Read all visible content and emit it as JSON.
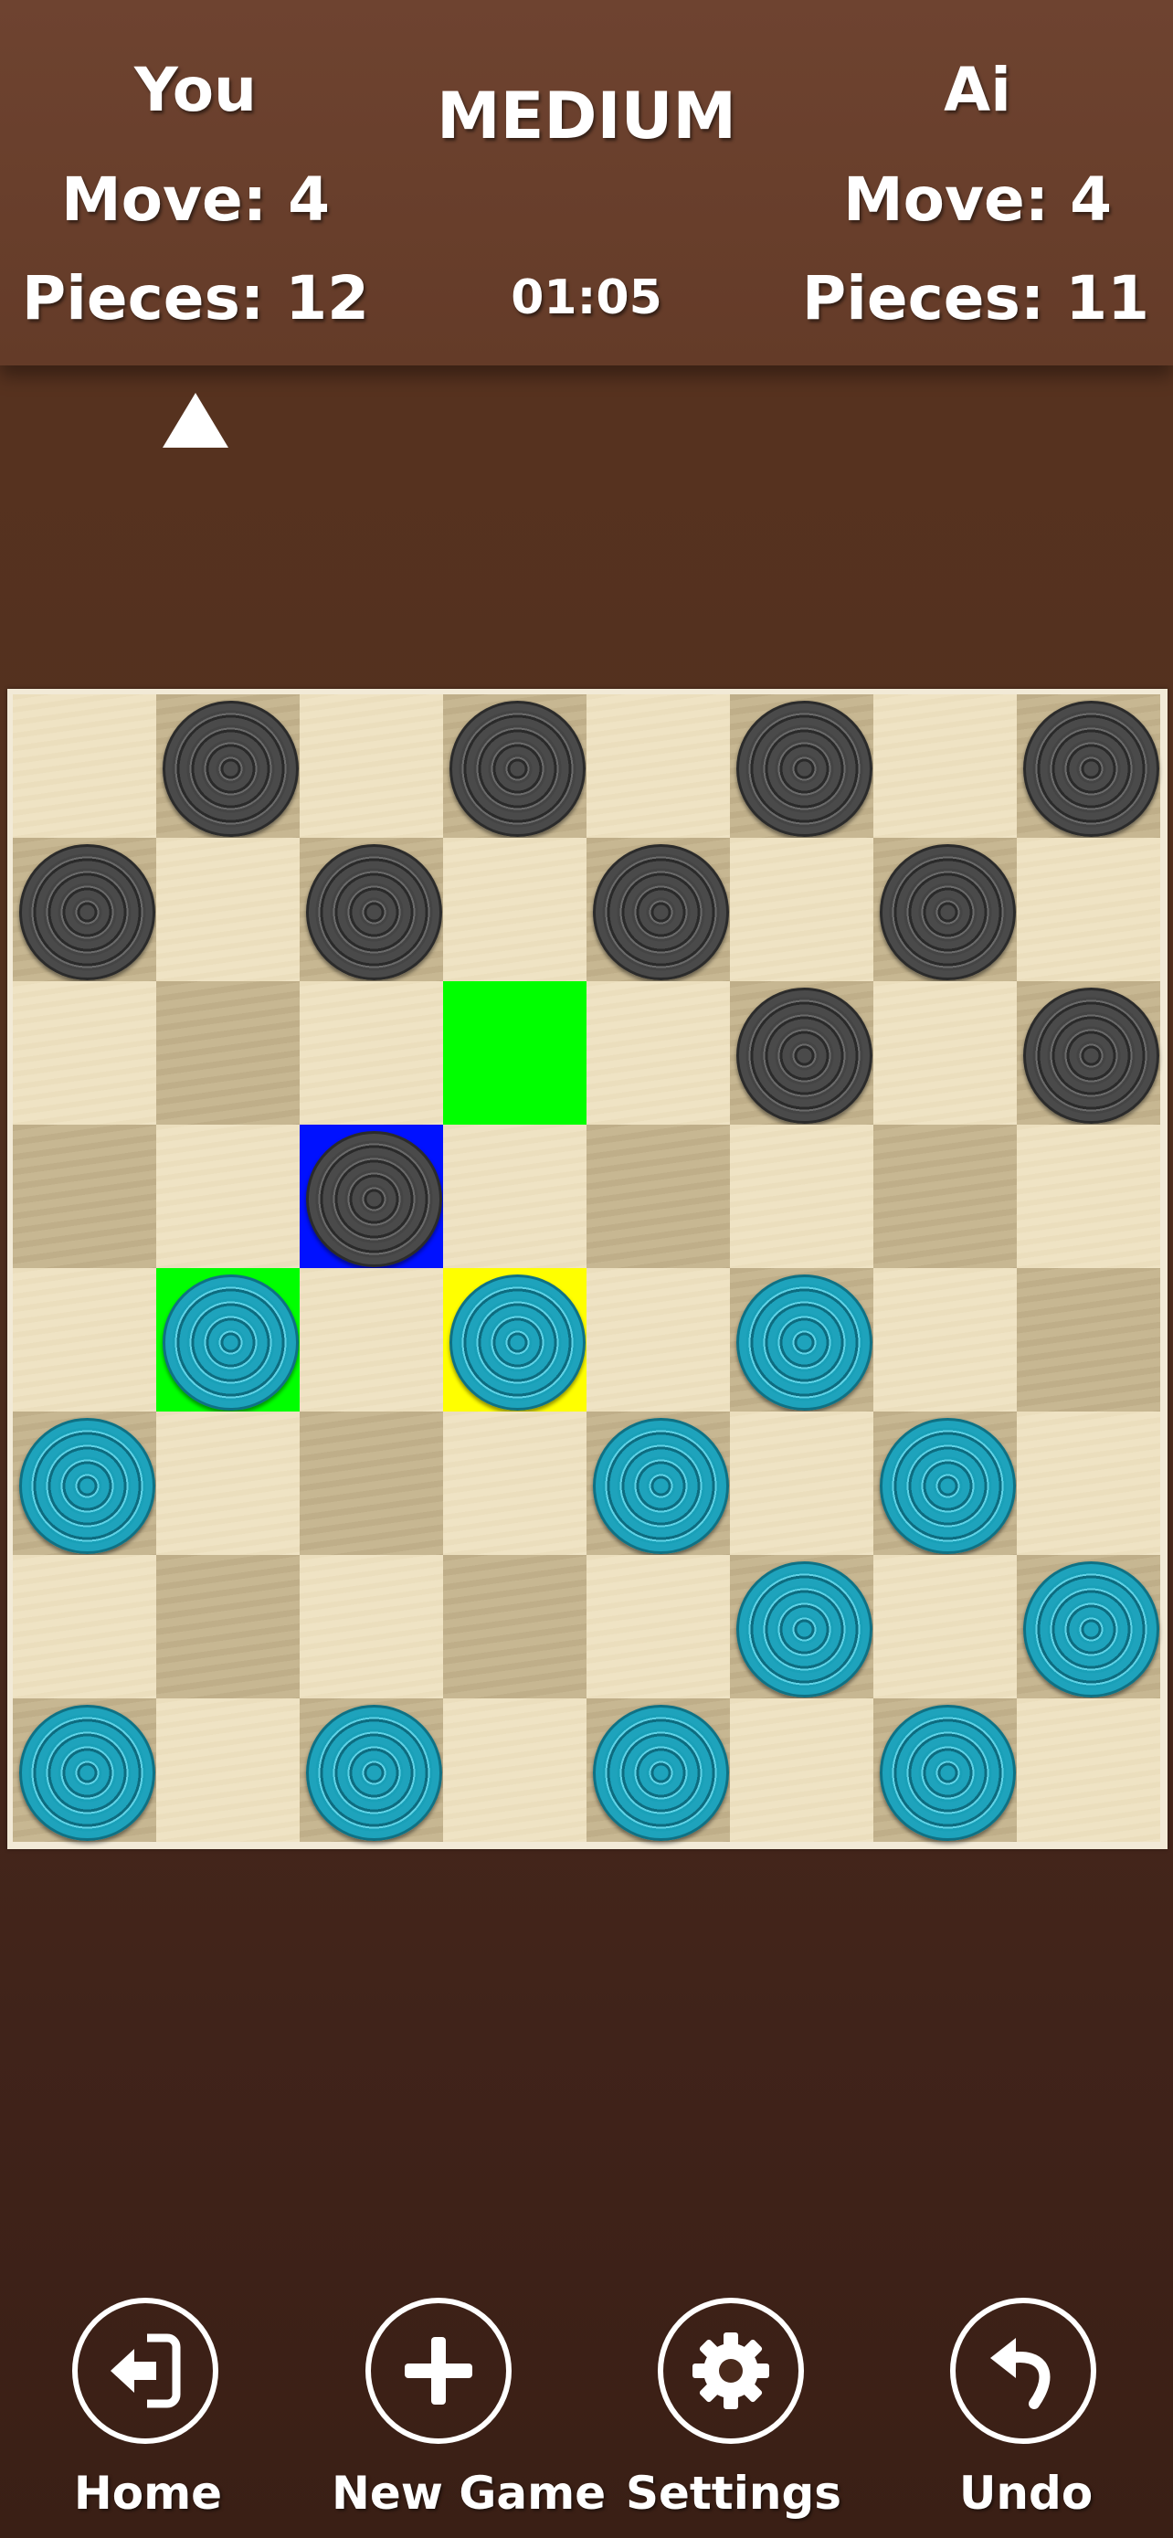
{
  "header": {
    "player": {
      "name": "You",
      "move": "Move: 4",
      "pieces": "Pieces: 12"
    },
    "difficulty": "MEDIUM",
    "timer": "01:05",
    "ai": {
      "name": "Ai",
      "move": "Move: 4",
      "pieces": "Pieces: 11"
    }
  },
  "colors": {
    "dark_piece": "#3a3a3a",
    "light_piece": "#1ea3bc",
    "selected_highlight": "#ffff00",
    "move_hint": "#00ff00",
    "last_move": "#0011ff"
  },
  "board": {
    "rows": [
      [
        "",
        "B",
        "",
        "B",
        "",
        "B",
        "",
        "B"
      ],
      [
        "B",
        "",
        "B",
        "",
        "B",
        "",
        "B",
        ""
      ],
      [
        "",
        "",
        "",
        "",
        "",
        "B",
        "",
        "B"
      ],
      [
        "",
        "",
        "B",
        "",
        "",
        "",
        "",
        ""
      ],
      [
        "",
        "W",
        "",
        "W",
        "",
        "W",
        "",
        ""
      ],
      [
        "W",
        "",
        "",
        "",
        "W",
        "",
        "W",
        ""
      ],
      [
        "",
        "",
        "",
        "",
        "",
        "W",
        "",
        "W"
      ],
      [
        "W",
        "",
        "W",
        "",
        "W",
        "",
        "W",
        ""
      ]
    ],
    "highlights": [
      {
        "row": 2,
        "col": 3,
        "type": "move_hint"
      },
      {
        "row": 4,
        "col": 1,
        "type": "move_hint"
      },
      {
        "row": 3,
        "col": 2,
        "type": "last_move"
      },
      {
        "row": 4,
        "col": 3,
        "type": "selected_highlight"
      }
    ]
  },
  "bottom_bar": {
    "home": {
      "label": "Home",
      "icon": "home-exit-icon"
    },
    "new_game": {
      "label": "New Game",
      "icon": "plus-icon"
    },
    "settings": {
      "label": "Settings",
      "icon": "gear-icon"
    },
    "undo": {
      "label": "Undo",
      "icon": "undo-arrow-icon"
    }
  }
}
